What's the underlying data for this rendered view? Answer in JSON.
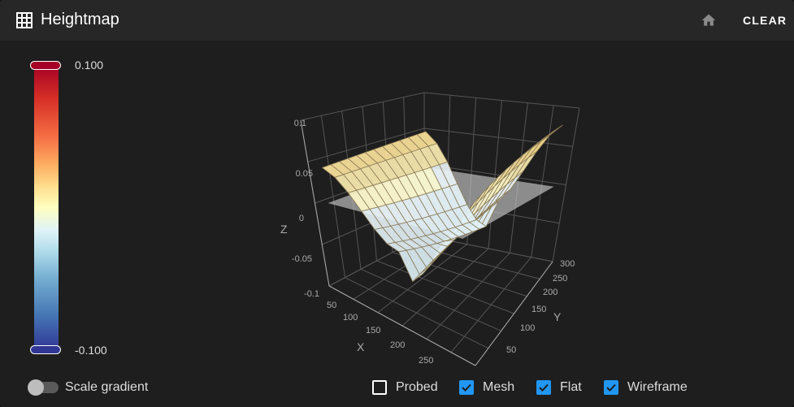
{
  "header": {
    "title": "Heightmap",
    "icon": "grid-icon",
    "home_icon": "home-icon",
    "clear_label": "CLEAR"
  },
  "colorbar": {
    "max_label": "0.100",
    "min_label": "-0.100",
    "colors": [
      "#a50026",
      "#f46d43",
      "#ffffbf",
      "#74add1",
      "#313695"
    ]
  },
  "plot": {
    "z_ticks": [
      "0.1",
      "0.05",
      "0",
      "-0.05",
      "-0.1"
    ],
    "x_ticks": [
      "50",
      "100",
      "150",
      "200",
      "250"
    ],
    "y_ticks": [
      "50",
      "100",
      "150",
      "200",
      "250",
      "300"
    ],
    "x_label": "X",
    "y_label": "Y",
    "z_label": "Z"
  },
  "footer": {
    "scale_gradient_label": "Scale gradient",
    "scale_gradient_on": false,
    "checkboxes": [
      {
        "label": "Probed",
        "checked": false
      },
      {
        "label": "Mesh",
        "checked": true
      },
      {
        "label": "Flat",
        "checked": true
      },
      {
        "label": "Wireframe",
        "checked": true
      }
    ]
  }
}
